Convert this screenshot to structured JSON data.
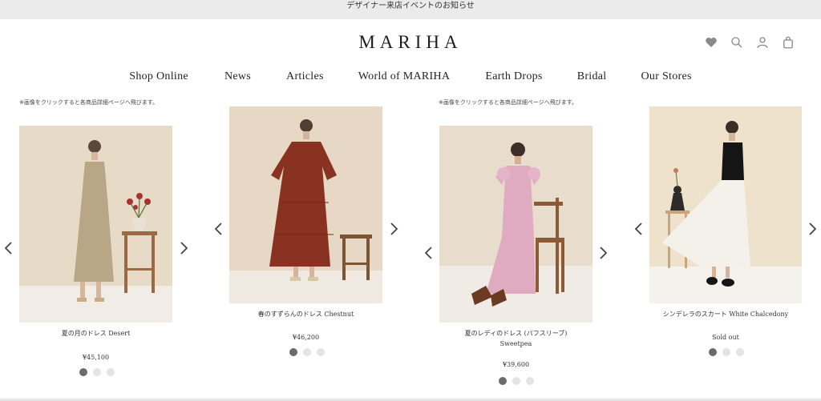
{
  "announcement": "デザイナー来店イベントのお知らせ",
  "brand": "MARIHA",
  "header_icons": [
    "heart-icon",
    "search-icon",
    "account-icon",
    "cart-icon"
  ],
  "nav": [
    "Shop Online",
    "News",
    "Articles",
    "World of MARIHA",
    "Earth Drops",
    "Bridal",
    "Our Stores"
  ],
  "note": "※画像をクリックすると各商品詳細ページへ飛びます。",
  "products": [
    {
      "name": "夏の月のドレス Desert",
      "price": "¥45,100",
      "colors": [
        "#6b6b6b",
        "#e4e4e4",
        "#e4e4e4"
      ]
    },
    {
      "name": "春のすずらんのドレス Chestnut",
      "price": "¥46,200",
      "colors": [
        "#6b6b6b",
        "#e4e4e4",
        "#e4e4e4"
      ]
    },
    {
      "name": "夏のレディのドレス (パフスリーブ)",
      "name2": "Sweetpea",
      "price": "¥39,600",
      "colors": [
        "#6b6b6b",
        "#e4e4e4",
        "#e4e4e4"
      ]
    },
    {
      "name": "シンデレラのスカート White Chalcedony",
      "price": "Sold out",
      "colors": [
        "#6b6b6b",
        "#e4e4e4",
        "#e4e4e4"
      ]
    }
  ],
  "colors": {
    "announce_bg": "#ebebeb",
    "photo_bg": "#e9dcc9",
    "active_dot": "#6b6b6b",
    "inactive_dot": "#e4e4e4"
  }
}
